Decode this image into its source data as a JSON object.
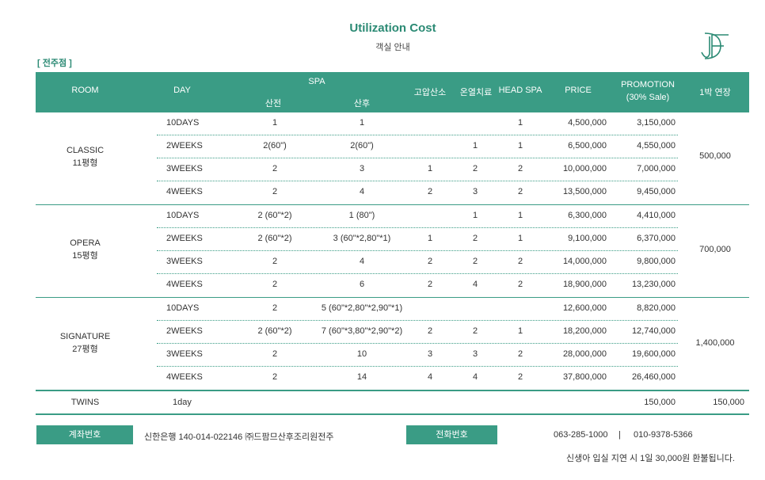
{
  "title": "Utilization Cost",
  "subtitle": "객실 안내",
  "branch": "[ 전주점 ]",
  "logo_icon": "df-monogram-logo",
  "colors": {
    "accent": "#3a9c85",
    "title": "#2b8a74"
  },
  "table": {
    "headers": {
      "room": "ROOM",
      "day": "DAY",
      "spa": "SPA",
      "spa_before": "산전",
      "spa_after": "산후",
      "oxygen": "고압산소",
      "thermal": "온열치료",
      "headspa": "HEAD SPA",
      "price": "PRICE",
      "promotion_1": "PROMOTION",
      "promotion_2": "(30% Sale)",
      "extension": "1박 연장"
    },
    "groups": [
      {
        "name": "CLASSIC",
        "size": "11평형",
        "extension": "500,000",
        "rows": [
          {
            "day": "10DAYS",
            "before": "1",
            "after": "1",
            "oxygen": "",
            "thermal": "",
            "headspa": "1",
            "price": "4,500,000",
            "promo": "3,150,000"
          },
          {
            "day": "2WEEKS",
            "before": "2(60\")",
            "after": "2(60\")",
            "oxygen": "",
            "thermal": "1",
            "headspa": "1",
            "price": "6,500,000",
            "promo": "4,550,000"
          },
          {
            "day": "3WEEKS",
            "before": "2",
            "after": "3",
            "oxygen": "1",
            "thermal": "2",
            "headspa": "2",
            "price": "10,000,000",
            "promo": "7,000,000"
          },
          {
            "day": "4WEEKS",
            "before": "2",
            "after": "4",
            "oxygen": "2",
            "thermal": "3",
            "headspa": "2",
            "price": "13,500,000",
            "promo": "9,450,000"
          }
        ]
      },
      {
        "name": "OPERA",
        "size": "15평형",
        "extension": "700,000",
        "rows": [
          {
            "day": "10DAYS",
            "before": "2 (60\"*2)",
            "after": "1 (80\")",
            "oxygen": "",
            "thermal": "1",
            "headspa": "1",
            "price": "6,300,000",
            "promo": "4,410,000"
          },
          {
            "day": "2WEEKS",
            "before": "2 (60\"*2)",
            "after": "3 (60\"*2,80\"*1)",
            "oxygen": "1",
            "thermal": "2",
            "headspa": "1",
            "price": "9,100,000",
            "promo": "6,370,000"
          },
          {
            "day": "3WEEKS",
            "before": "2",
            "after": "4",
            "oxygen": "2",
            "thermal": "2",
            "headspa": "2",
            "price": "14,000,000",
            "promo": "9,800,000"
          },
          {
            "day": "4WEEKS",
            "before": "2",
            "after": "6",
            "oxygen": "2",
            "thermal": "4",
            "headspa": "2",
            "price": "18,900,000",
            "promo": "13,230,000"
          }
        ]
      },
      {
        "name": "SIGNATURE",
        "size": "27평형",
        "extension": "1,400,000",
        "rows": [
          {
            "day": "10DAYS",
            "before": "2",
            "after": "5 (60\"*2,80\"*2,90\"*1)",
            "oxygen": "",
            "thermal": "",
            "headspa": "",
            "price": "12,600,000",
            "promo": "8,820,000"
          },
          {
            "day": "2WEEKS",
            "before": "2 (60\"*2)",
            "after": "7 (60\"*3,80\"*2,90\"*2)",
            "oxygen": "2",
            "thermal": "2",
            "headspa": "1",
            "price": "18,200,000",
            "promo": "12,740,000"
          },
          {
            "day": "3WEEKS",
            "before": "2",
            "after": "10",
            "oxygen": "3",
            "thermal": "3",
            "headspa": "2",
            "price": "28,000,000",
            "promo": "19,600,000"
          },
          {
            "day": "4WEEKS",
            "before": "2",
            "after": "14",
            "oxygen": "4",
            "thermal": "4",
            "headspa": "2",
            "price": "37,800,000",
            "promo": "26,460,000"
          }
        ]
      }
    ],
    "twins": {
      "name": "TWINS",
      "day": "1day",
      "promo": "150,000",
      "extension": "150,000"
    }
  },
  "footer": {
    "account_label": "계좌번호",
    "account_value": "신한은행 140-014-022146 ㈜드팜므산후조리원전주",
    "phone_label": "전화번호",
    "phone_1": "063-285-1000",
    "phone_sep": "|",
    "phone_2": "010-9378-5366",
    "note": "신생아 입실 지연 시 1일 30,000원 환불됩니다."
  }
}
